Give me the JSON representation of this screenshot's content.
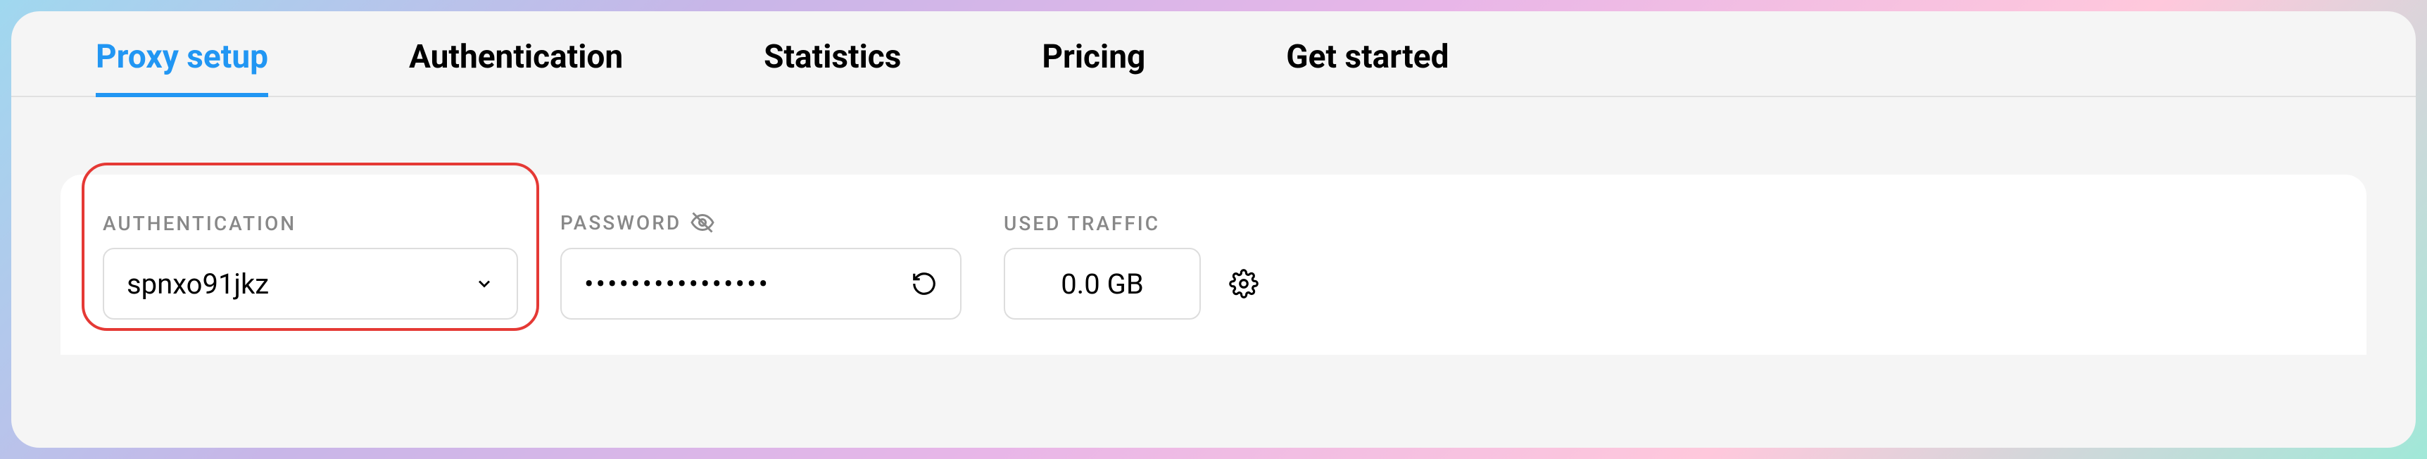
{
  "tabs": {
    "proxy_setup": "Proxy setup",
    "authentication": "Authentication",
    "statistics": "Statistics",
    "pricing": "Pricing",
    "get_started": "Get started"
  },
  "fields": {
    "authentication": {
      "label": "AUTHENTICATION",
      "value": "spnxo91jkz"
    },
    "password": {
      "label": "PASSWORD",
      "value": "••••••••••••••••"
    },
    "used_traffic": {
      "label": "USED TRAFFIC",
      "value": "0.0 GB"
    }
  }
}
